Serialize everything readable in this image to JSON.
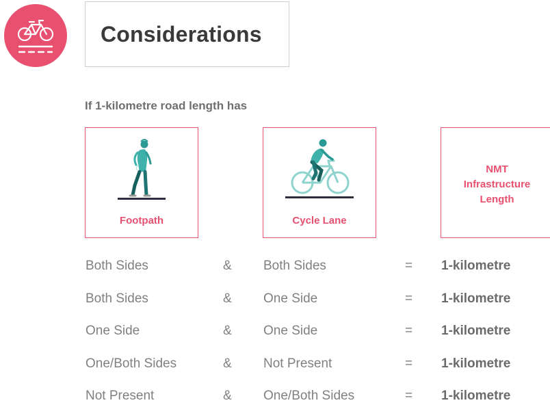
{
  "header": {
    "logo_icon": "bicycle-icon",
    "title": "Considerations"
  },
  "subtitle": "If 1-kilometre road length has",
  "accent_color": "#e8506f",
  "cards": {
    "footpath": {
      "icon": "pedestrian-icon",
      "label": "Footpath"
    },
    "cycle_lane": {
      "icon": "cyclist-icon",
      "label": "Cycle Lane"
    },
    "nmt": {
      "label_lines": [
        "NMT",
        "Infrastructure",
        "Length"
      ]
    }
  },
  "rows": [
    {
      "footpath": "Both Sides",
      "op": "&",
      "cycle_lane": "Both Sides",
      "eq": "=",
      "result": "1-kilometre"
    },
    {
      "footpath": "Both Sides",
      "op": "&",
      "cycle_lane": "One Side",
      "eq": "=",
      "result": "1-kilometre"
    },
    {
      "footpath": "One Side",
      "op": "&",
      "cycle_lane": "One Side",
      "eq": "=",
      "result": "1-kilometre"
    },
    {
      "footpath": "One/Both Sides",
      "op": "&",
      "cycle_lane": "Not Present",
      "eq": "=",
      "result": "1-kilometre"
    },
    {
      "footpath": "Not Present",
      "op": "&",
      "cycle_lane": "One/Both Sides",
      "eq": "=",
      "result": "1-kilometre"
    }
  ]
}
